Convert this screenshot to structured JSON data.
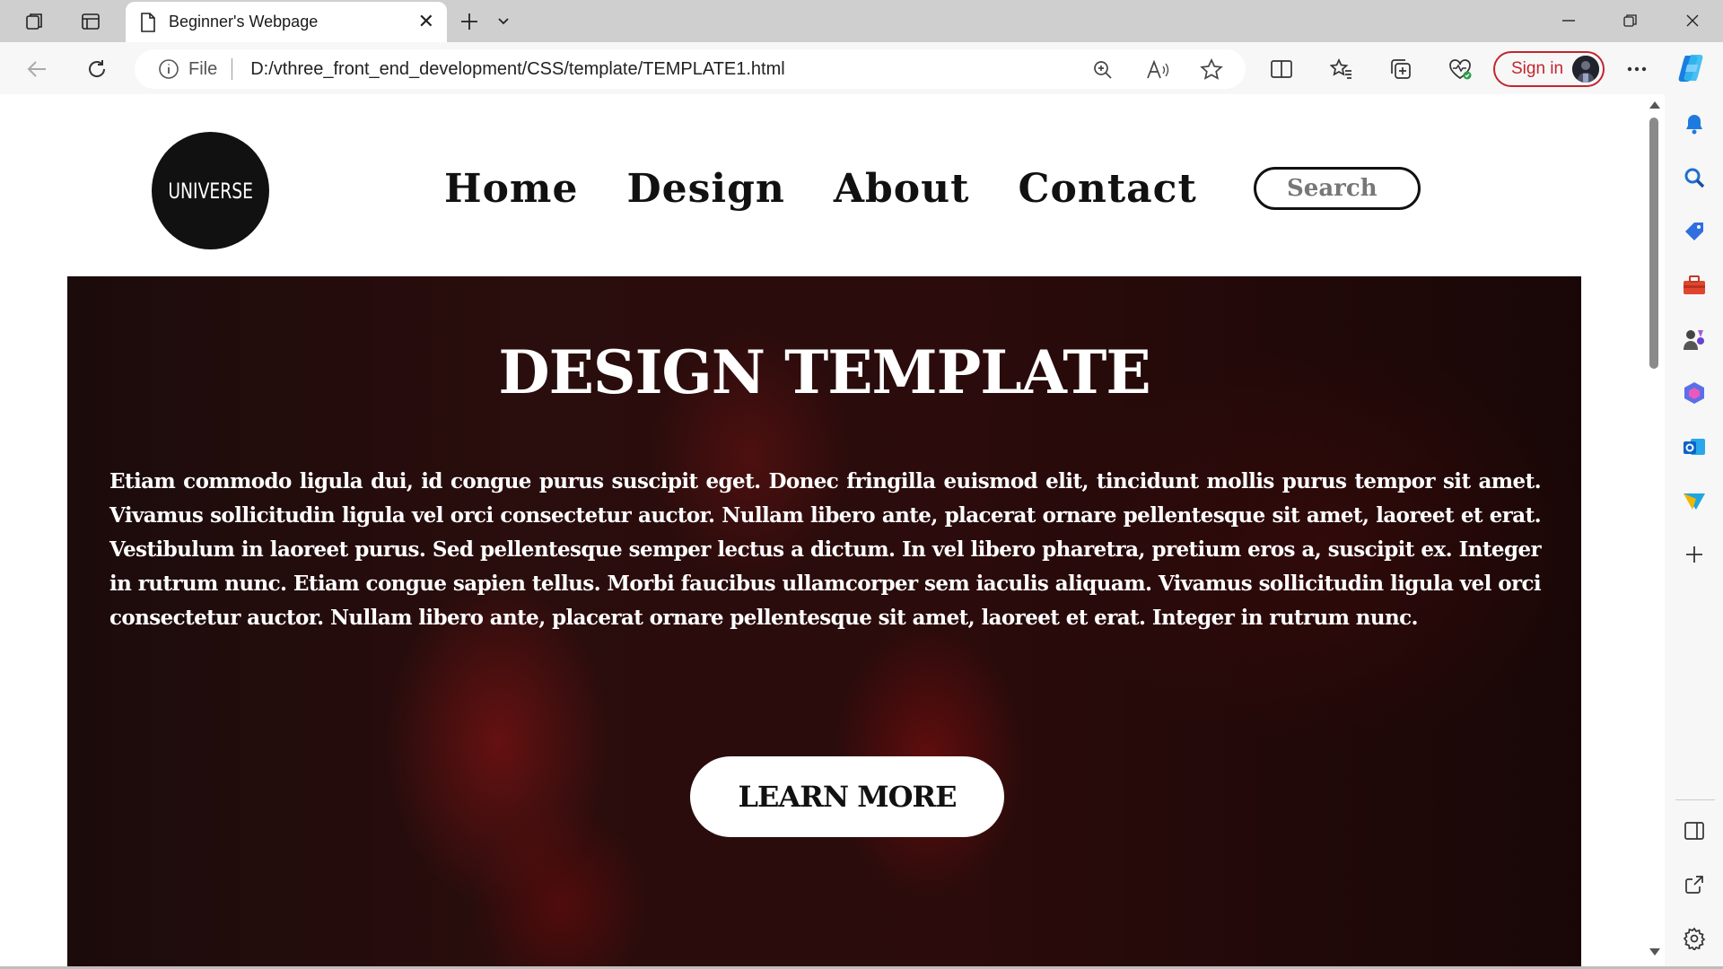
{
  "browser": {
    "tab_title": "Beginner's Webpage",
    "address": {
      "scheme_label": "File",
      "url": "D:/vthree_front_end_development/CSS/template/TEMPLATE1.html"
    },
    "signin_label": "Sign in",
    "icons": [
      "workspaces-icon",
      "tab-actions-icon",
      "page-icon",
      "close-tab-icon",
      "new-tab-icon",
      "tab-list-chevron-icon",
      "minimize-icon",
      "restore-icon",
      "close-window-icon",
      "back-arrow-icon",
      "refresh-icon",
      "info-icon",
      "zoom-icon",
      "read-aloud-icon",
      "favorite-star-icon",
      "split-screen-icon",
      "favorites-icon",
      "collections-icon",
      "browser-essentials-icon",
      "more-icon",
      "copilot-icon"
    ]
  },
  "sidebar": {
    "icons": [
      "bell-icon",
      "search-icon",
      "shopping-tag-icon",
      "toolbox-icon",
      "games-icon",
      "office-icon",
      "outlook-icon",
      "send-icon",
      "add-icon",
      "sidebar-panel-icon",
      "open-external-icon",
      "settings-gear-icon"
    ]
  },
  "page": {
    "logo_text": "UNIVERSE",
    "nav": [
      "Home",
      "Design",
      "About",
      "Contact"
    ],
    "search_placeholder": "Search",
    "hero": {
      "title": "DESIGN TEMPLATE",
      "body": "Etiam commodo ligula dui, id congue purus suscipit eget. Donec fringilla euismod elit, tincidunt mollis purus tempor sit amet. Vivamus sollicitudin ligula vel orci consectetur auctor. Nullam libero ante, placerat ornare pellentesque sit amet, laoreet et erat. Vestibulum in laoreet purus. Sed pellentesque semper lectus a dictum. In vel libero pharetra, pretium eros a, suscipit ex. Integer in rutrum nunc. Etiam congue sapien tellus. Morbi faucibus ullamcorper sem iaculis aliquam. Vivamus sollicitudin ligula vel orci consectetur auctor. Nullam libero ante, placerat ornare pellentesque sit amet, laoreet et erat. Integer in rutrum nunc.",
      "button_label": "LEARN MORE"
    }
  },
  "colors": {
    "accent_signin": "#c2262e",
    "hero_dark": "#1c0b0b",
    "hero_red": "#8c1414"
  }
}
